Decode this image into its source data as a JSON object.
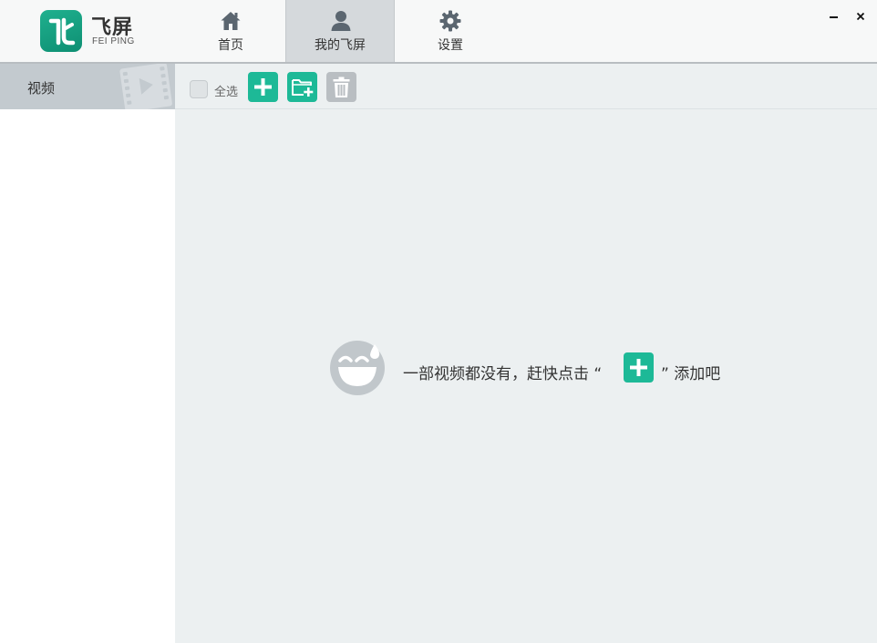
{
  "app": {
    "brand_cn": "飞屏",
    "brand_en": "FEI PING"
  },
  "nav": {
    "tabs": [
      {
        "label": "首页",
        "icon": "home-icon"
      },
      {
        "label": "我的飞屏",
        "icon": "user-icon",
        "active": true
      },
      {
        "label": "设置",
        "icon": "gear-icon"
      }
    ]
  },
  "window": {
    "minimize_icon": "minimize-icon",
    "close_icon": "close-icon"
  },
  "sidebar": {
    "items": [
      {
        "label": "视频",
        "icon": "film-icon",
        "active": true
      }
    ]
  },
  "toolbar": {
    "select_all": "全选",
    "select_all_checked": false,
    "buttons": [
      {
        "name": "add",
        "icon": "plus-icon"
      },
      {
        "name": "add-folder",
        "icon": "folder-add-icon"
      },
      {
        "name": "delete",
        "icon": "trash-icon",
        "disabled": true
      }
    ]
  },
  "empty_state": {
    "text_before": "一部视频都没有，赶快点击 “",
    "text_after": "” 添加吧",
    "icon": "sweat-smile-icon"
  },
  "colors": {
    "accent": "#1db997",
    "sidebar_active": "#c3cacf",
    "main_bg": "#ecf0f1",
    "tab_active": "#d5d9dc"
  }
}
